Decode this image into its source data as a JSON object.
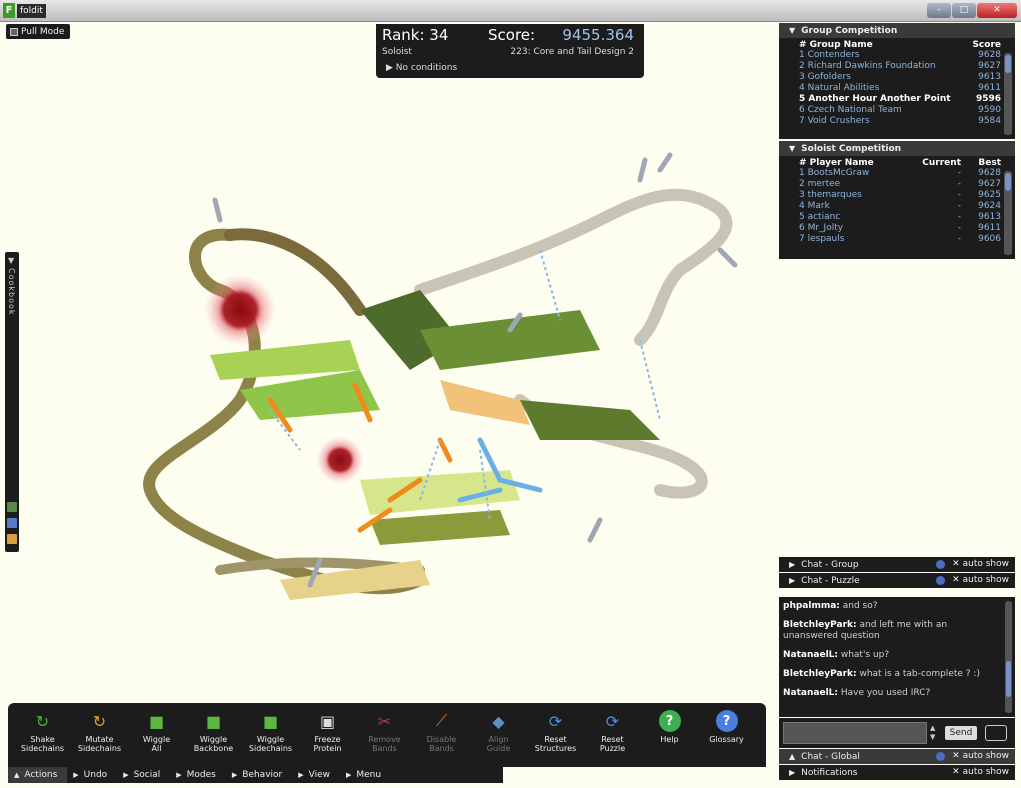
{
  "window": {
    "title": "foldit"
  },
  "pull_mode": {
    "label": "Pull Mode"
  },
  "score_panel": {
    "rank": "Rank: 34",
    "score_label": "Score:",
    "score_value": "9455.364",
    "mode": "Soloist",
    "puzzle": "223: Core and Tail Design 2",
    "conditions": "No conditions"
  },
  "cookbook": {
    "label": "Cookbook"
  },
  "group_competition": {
    "title": "Group Competition",
    "header": {
      "name": "# Group Name",
      "score": "Score"
    },
    "rows": [
      {
        "name": "1 Contenders",
        "score": "9628",
        "highlight": false
      },
      {
        "name": "2 Richard Dawkins Foundation",
        "score": "9627",
        "highlight": false
      },
      {
        "name": "3 Gofolders",
        "score": "9613",
        "highlight": false
      },
      {
        "name": "4 Natural Abilities",
        "score": "9611",
        "highlight": false
      },
      {
        "name": "5 Another Hour Another Point",
        "score": "9596",
        "highlight": true
      },
      {
        "name": "6 Czech National Team",
        "score": "9590",
        "highlight": false
      },
      {
        "name": "7 Void Crushers",
        "score": "9584",
        "highlight": false
      }
    ]
  },
  "soloist_competition": {
    "title": "Soloist Competition",
    "header": {
      "name": "# Player Name",
      "current": "Current",
      "best": "Best"
    },
    "rows": [
      {
        "name": "1 BootsMcGraw",
        "current": "-",
        "best": "9628"
      },
      {
        "name": "2 mertee",
        "current": "-",
        "best": "9627"
      },
      {
        "name": "3 themarques",
        "current": "-",
        "best": "9625"
      },
      {
        "name": "4 Mark",
        "current": "-",
        "best": "9624"
      },
      {
        "name": "5 actianc",
        "current": "-",
        "best": "9613"
      },
      {
        "name": "6 Mr_Jolty",
        "current": "-",
        "best": "9611"
      },
      {
        "name": "7 lespauls",
        "current": "-",
        "best": "9606"
      }
    ]
  },
  "chat": {
    "group": {
      "label": "Chat - Group",
      "auto": "auto show"
    },
    "puzzle": {
      "label": "Chat - Puzzle",
      "auto": "auto show"
    },
    "global": {
      "label": "Chat - Global",
      "auto": "auto show"
    },
    "notifications": {
      "label": "Notifications",
      "auto": "auto show"
    },
    "messages": [
      {
        "user": "phpalmma:",
        "text": " and so?"
      },
      {
        "user": "BletchleyPark:",
        "text": " and left me with an unanswered question"
      },
      {
        "user": "NatanaelL:",
        "text": " what's up?"
      },
      {
        "user": "BletchleyPark:",
        "text": " what is a tab-complete ? :)"
      },
      {
        "user": "NatanaelL:",
        "text": " Have you used IRC?"
      }
    ],
    "send_label": "Send"
  },
  "toolbar": {
    "tools": [
      {
        "label": "Shake\nSidechains",
        "icon": "shake-icon",
        "color": "#4caf3c",
        "enabled": true
      },
      {
        "label": "Mutate\nSidechains",
        "icon": "mutate-icon",
        "color": "#e0a020",
        "enabled": true
      },
      {
        "label": "Wiggle\nAll",
        "icon": "wiggle-all-icon",
        "color": "#5cb840",
        "enabled": true
      },
      {
        "label": "Wiggle\nBackbone",
        "icon": "wiggle-backbone-icon",
        "color": "#5cb840",
        "enabled": true
      },
      {
        "label": "Wiggle\nSidechains",
        "icon": "wiggle-sidechains-icon",
        "color": "#5cb840",
        "enabled": true
      },
      {
        "label": "Freeze\nProtein",
        "icon": "freeze-icon",
        "color": "#dddddd",
        "enabled": true
      },
      {
        "label": "Remove\nBands",
        "icon": "scissors-icon",
        "color": "#b04040",
        "enabled": false
      },
      {
        "label": "Disable\nBands",
        "icon": "broom-icon",
        "color": "#c08040",
        "enabled": false
      },
      {
        "label": "Align\nGuide",
        "icon": "align-icon",
        "color": "#5a8fc8",
        "enabled": false
      },
      {
        "label": "Reset\nStructures",
        "icon": "reset-structures-icon",
        "color": "#4a8fe0",
        "enabled": true
      },
      {
        "label": "Reset\nPuzzle",
        "icon": "reset-puzzle-icon",
        "color": "#4a8fe0",
        "enabled": true
      },
      {
        "label": "Help",
        "icon": "help-icon",
        "color": "#3cb050",
        "enabled": true
      },
      {
        "label": "Glossary",
        "icon": "glossary-icon",
        "color": "#4a7fe0",
        "enabled": true
      }
    ]
  },
  "bottom_tabs": [
    {
      "label": "Actions",
      "active": true,
      "arrow": "▲"
    },
    {
      "label": "Undo",
      "active": false,
      "arrow": "▶"
    },
    {
      "label": "Social",
      "active": false,
      "arrow": "▶"
    },
    {
      "label": "Modes",
      "active": false,
      "arrow": "▶"
    },
    {
      "label": "Behavior",
      "active": false,
      "arrow": "▶"
    },
    {
      "label": "View",
      "active": false,
      "arrow": "▶"
    },
    {
      "label": "Menu",
      "active": false,
      "arrow": "▶"
    }
  ]
}
